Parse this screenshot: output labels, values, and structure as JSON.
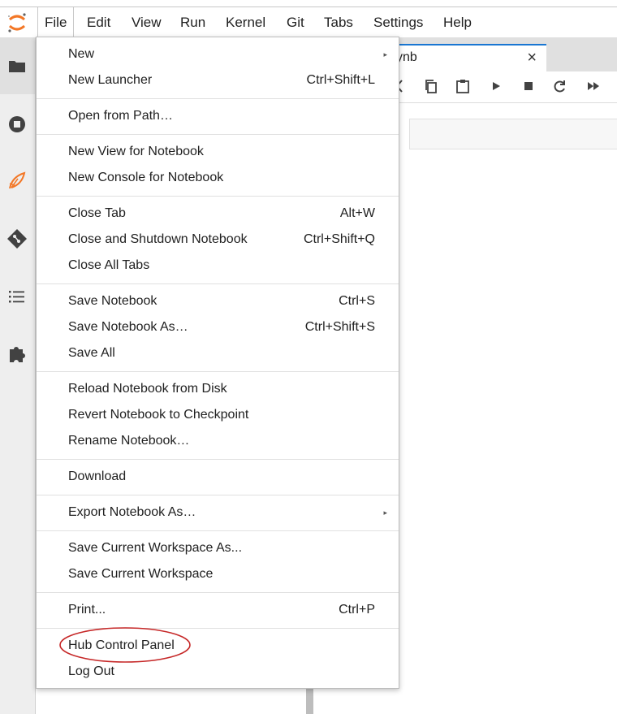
{
  "menubar": {
    "items": [
      "File",
      "Edit",
      "View",
      "Run",
      "Kernel",
      "Git",
      "Tabs",
      "Settings",
      "Help"
    ],
    "active": "File"
  },
  "notebook_tab": {
    "label": "ynb",
    "close_glyph": "×"
  },
  "file_menu": {
    "items": [
      {
        "label": "New",
        "shortcut": "",
        "submenu": true
      },
      {
        "label": "New Launcher",
        "shortcut": "Ctrl+Shift+L"
      },
      {
        "label": "Open from Path…",
        "shortcut": ""
      },
      {
        "label": "New View for Notebook",
        "shortcut": ""
      },
      {
        "label": "New Console for Notebook",
        "shortcut": ""
      },
      {
        "label": "Close Tab",
        "shortcut": "Alt+W"
      },
      {
        "label": "Close and Shutdown Notebook",
        "shortcut": "Ctrl+Shift+Q"
      },
      {
        "label": "Close All Tabs",
        "shortcut": ""
      },
      {
        "label": "Save Notebook",
        "shortcut": "Ctrl+S"
      },
      {
        "label": "Save Notebook As…",
        "shortcut": "Ctrl+Shift+S"
      },
      {
        "label": "Save All",
        "shortcut": ""
      },
      {
        "label": "Reload Notebook from Disk",
        "shortcut": ""
      },
      {
        "label": "Revert Notebook to Checkpoint",
        "shortcut": ""
      },
      {
        "label": "Rename Notebook…",
        "shortcut": ""
      },
      {
        "label": "Download",
        "shortcut": ""
      },
      {
        "label": "Export Notebook As…",
        "shortcut": "",
        "submenu": true
      },
      {
        "label": "Save Current Workspace As...",
        "shortcut": ""
      },
      {
        "label": "Save Current Workspace",
        "shortcut": ""
      },
      {
        "label": "Print...",
        "shortcut": "Ctrl+P"
      },
      {
        "label": "Hub Control Panel",
        "shortcut": "",
        "highlighted": true
      },
      {
        "label": "Log Out",
        "shortcut": ""
      }
    ],
    "submenu_glyph": "▸"
  },
  "colors": {
    "accent": "#1976d2",
    "highlight_ellipse": "#c62828",
    "jupyter_orange": "#f37726",
    "icon_dark": "#424242"
  },
  "left_sidebar_icons": [
    "folder-icon",
    "running-sessions-icon",
    "sidebar-app-icon",
    "git-icon",
    "table-of-contents-icon",
    "extension-icon"
  ],
  "toolbar_icons": [
    "cut-icon",
    "copy-icon",
    "paste-icon",
    "run-icon",
    "stop-icon",
    "restart-icon",
    "fast-forward-icon"
  ]
}
